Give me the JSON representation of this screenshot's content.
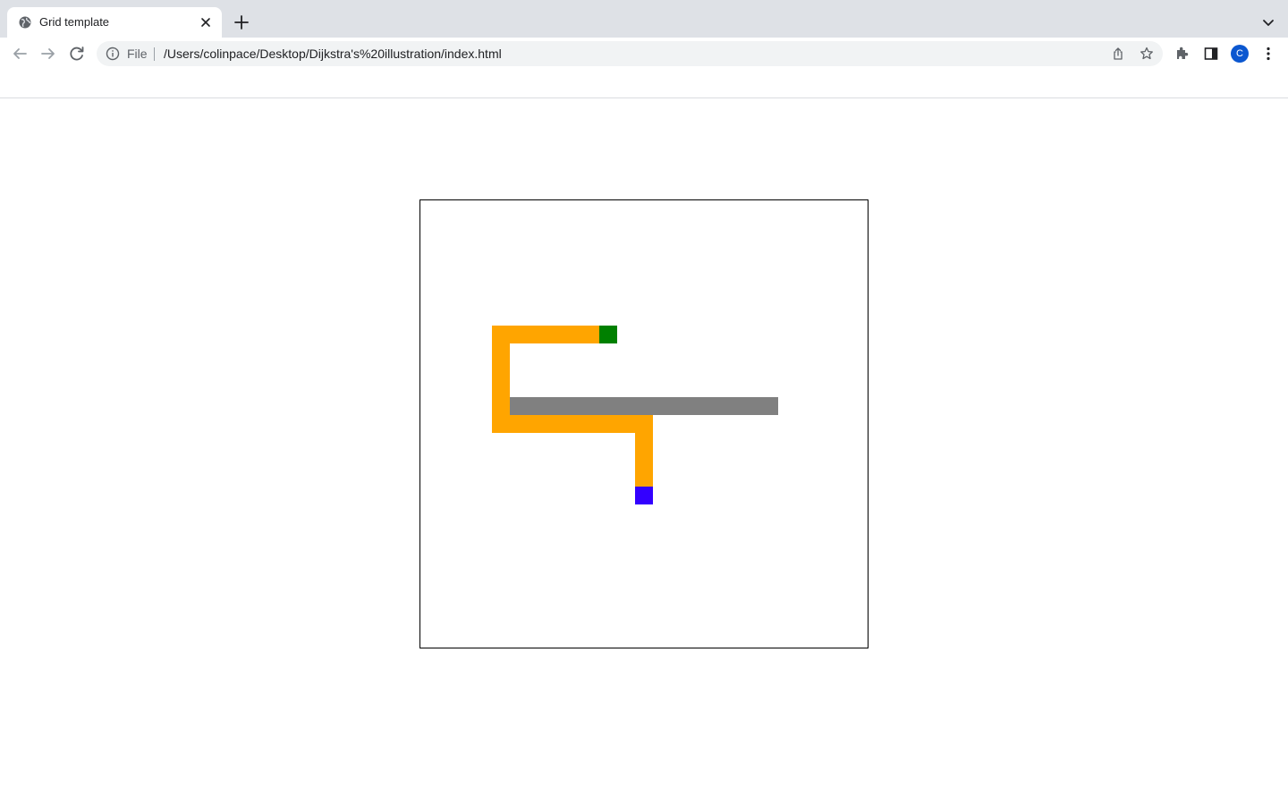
{
  "browser": {
    "tab": {
      "title": "Grid template",
      "favicon_icon": "globe-icon"
    },
    "address_bar": {
      "scheme_label": "File",
      "url": "/Users/colinpace/Desktop/Dijkstra's%20illustration/index.html"
    },
    "profile": {
      "initial": "C"
    }
  },
  "grid": {
    "columns": 25,
    "rows": 25,
    "colors": {
      "path": "#ffa500",
      "wall": "#808080",
      "start": "#008000",
      "end": "#3300ff"
    },
    "start": [
      10,
      7
    ],
    "end": [
      12,
      16
    ],
    "walls": [
      [
        5,
        11
      ],
      [
        6,
        11
      ],
      [
        7,
        11
      ],
      [
        8,
        11
      ],
      [
        9,
        11
      ],
      [
        10,
        11
      ],
      [
        11,
        11
      ],
      [
        12,
        11
      ],
      [
        13,
        11
      ],
      [
        14,
        11
      ],
      [
        15,
        11
      ],
      [
        16,
        11
      ],
      [
        17,
        11
      ],
      [
        18,
        11
      ],
      [
        19,
        11
      ]
    ],
    "path": [
      [
        9,
        7
      ],
      [
        8,
        7
      ],
      [
        7,
        7
      ],
      [
        6,
        7
      ],
      [
        5,
        7
      ],
      [
        4,
        7
      ],
      [
        4,
        8
      ],
      [
        4,
        9
      ],
      [
        4,
        10
      ],
      [
        4,
        11
      ],
      [
        4,
        12
      ],
      [
        5,
        12
      ],
      [
        6,
        12
      ],
      [
        7,
        12
      ],
      [
        8,
        12
      ],
      [
        9,
        12
      ],
      [
        10,
        12
      ],
      [
        11,
        12
      ],
      [
        12,
        12
      ],
      [
        12,
        13
      ],
      [
        12,
        14
      ],
      [
        12,
        15
      ]
    ]
  }
}
